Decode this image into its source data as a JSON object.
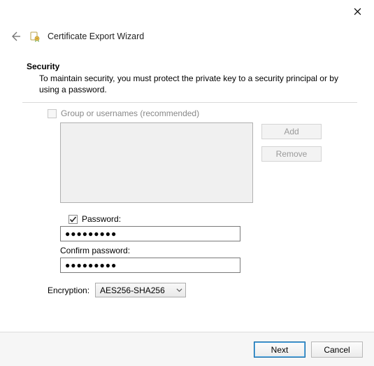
{
  "window": {
    "title": "Certificate Export Wizard"
  },
  "page": {
    "heading": "Security",
    "description": "To maintain security, you must protect the private key to a security principal or by using a password."
  },
  "groups": {
    "checkbox_label": "Group or usernames (recommended)",
    "add_label": "Add",
    "remove_label": "Remove"
  },
  "password": {
    "checkbox_label": "Password:",
    "value_masked": "●●●●●●●●●",
    "confirm_label": "Confirm password:",
    "confirm_value_masked": "●●●●●●●●●"
  },
  "encryption": {
    "label": "Encryption:",
    "selected": "AES256-SHA256"
  },
  "footer": {
    "next_label": "Next",
    "cancel_label": "Cancel"
  }
}
